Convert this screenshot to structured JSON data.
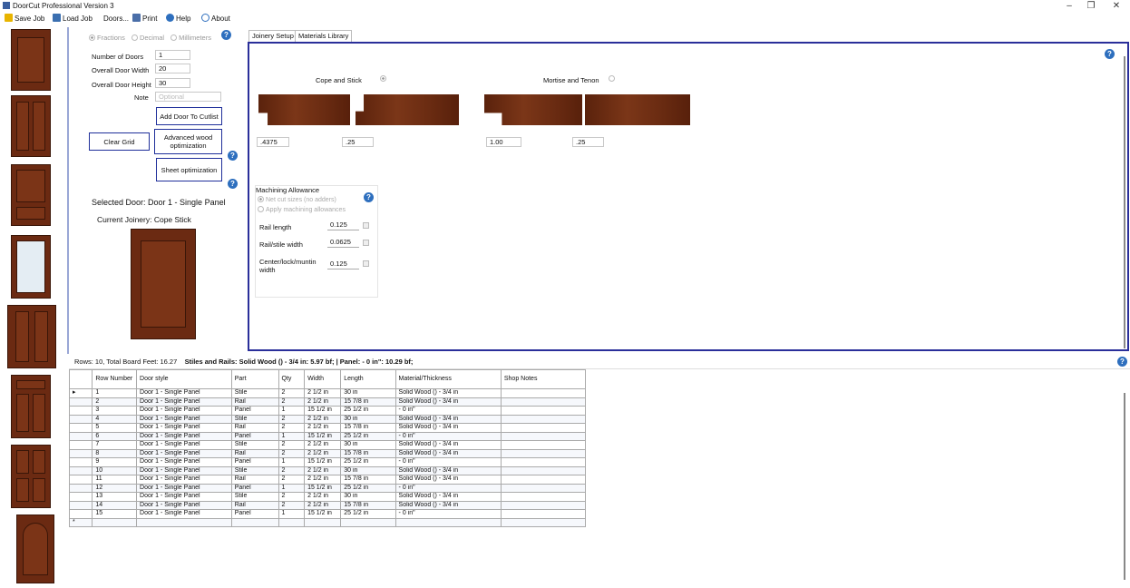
{
  "window": {
    "title": "DoorCut Professional Version 3",
    "minimize": "–",
    "maximize": "❐",
    "close": "✕"
  },
  "menu": {
    "save": "Save Job",
    "load": "Load Job",
    "doors": "Doors...",
    "print": "Print",
    "help": "Help",
    "about": "About"
  },
  "units": {
    "fractions": "Fractions",
    "decimal": "Decimal",
    "millimeters": "Millimeters",
    "selected": "Fractions"
  },
  "form": {
    "num_doors_label": "Number of Doors",
    "num_doors": "1",
    "width_label": "Overall Door Width",
    "width": "20",
    "height_label": "Overall Door Height",
    "height": "30",
    "note_label": "Note",
    "note_placeholder": "Optional"
  },
  "buttons": {
    "add": "Add Door To Cutlist",
    "clear": "Clear Grid",
    "advanced": "Advanced wood optimization",
    "sheet": "Sheet optimization"
  },
  "selected_door": "Selected Door: Door 1 - Single Panel",
  "current_joinery": "Current Joinery: Cope  Stick",
  "tabs": [
    "Joinery Setup",
    "Materials Library"
  ],
  "joinery": {
    "cope_label": "Cope and Stick",
    "mortise_label": "Mortise and Tenon",
    "cope_a": ".4375",
    "cope_b": ".25",
    "mortise_a": "1.00",
    "mortise_b": ".25"
  },
  "machining": {
    "title": "Machining Allowance",
    "opt1": "Net cut sizes (no adders)",
    "opt2": "Apply machining allowances",
    "rail_length_label": "Rail length",
    "rail_length": "0.125",
    "rail_stile_label": "Rail/stile width",
    "rail_stile": "0.0625",
    "center_label": "Center/lock/muntin width",
    "center": "0.125"
  },
  "grid_info": {
    "rows": "Rows: 10, Total Board Feet: 16.27",
    "summary": "Stiles and Rails: Solid Wood () - 3/4 in: 5.97 bf;  | Panel:  - 0 in\": 10.29 bf;"
  },
  "grid": {
    "headers": [
      "Row Number",
      "Door style",
      "Part",
      "Qty",
      "Width",
      "Length",
      "Material/Thickness",
      "Shop Notes"
    ],
    "rows": [
      [
        "1",
        "Door 1 - Single Panel",
        "Stile",
        "2",
        "2 1/2 in",
        "30 in",
        "Solid Wood () - 3/4 in",
        ""
      ],
      [
        "2",
        "Door 1 - Single Panel",
        "Rail",
        "2",
        "2 1/2 in",
        "15 7/8 in",
        "Solid Wood () - 3/4 in",
        ""
      ],
      [
        "3",
        "Door 1 - Single Panel",
        "Panel",
        "1",
        "15 1/2 in",
        "25 1/2 in",
        " - 0 in\"",
        ""
      ],
      [
        "4",
        "Door 1 - Single Panel",
        "Stile",
        "2",
        "2 1/2 in",
        "30 in",
        "Solid Wood () - 3/4 in",
        ""
      ],
      [
        "5",
        "Door 1 - Single Panel",
        "Rail",
        "2",
        "2 1/2 in",
        "15 7/8 in",
        "Solid Wood () - 3/4 in",
        ""
      ],
      [
        "6",
        "Door 1 - Single Panel",
        "Panel",
        "1",
        "15 1/2 in",
        "25 1/2 in",
        " - 0 in\"",
        ""
      ],
      [
        "7",
        "Door 1 - Single Panel",
        "Stile",
        "2",
        "2 1/2 in",
        "30 in",
        "Solid Wood () - 3/4 in",
        ""
      ],
      [
        "8",
        "Door 1 - Single Panel",
        "Rail",
        "2",
        "2 1/2 in",
        "15 7/8 in",
        "Solid Wood () - 3/4 in",
        ""
      ],
      [
        "9",
        "Door 1 - Single Panel",
        "Panel",
        "1",
        "15 1/2 in",
        "25 1/2 in",
        " - 0 in\"",
        ""
      ],
      [
        "10",
        "Door 1 - Single Panel",
        "Stile",
        "2",
        "2 1/2 in",
        "30 in",
        "Solid Wood () - 3/4 in",
        ""
      ],
      [
        "11",
        "Door 1 - Single Panel",
        "Rail",
        "2",
        "2 1/2 in",
        "15 7/8 in",
        "Solid Wood () - 3/4 in",
        ""
      ],
      [
        "12",
        "Door 1 - Single Panel",
        "Panel",
        "1",
        "15 1/2 in",
        "25 1/2 in",
        " - 0 in\"",
        ""
      ],
      [
        "13",
        "Door 1 - Single Panel",
        "Stile",
        "2",
        "2 1/2 in",
        "30 in",
        "Solid Wood () - 3/4 in",
        ""
      ],
      [
        "14",
        "Door 1 - Single Panel",
        "Rail",
        "2",
        "2 1/2 in",
        "15 7/8 in",
        "Solid Wood () - 3/4 in",
        ""
      ],
      [
        "15",
        "Door 1 - Single Panel",
        "Panel",
        "1",
        "15 1/2 in",
        "25 1/2 in",
        " - 0 in\"",
        ""
      ]
    ],
    "new_row_marker": "*",
    "current_row_marker": "▸"
  },
  "colors": {
    "accent": "#2a2f9a",
    "wood": "#6b2a12",
    "help": "#2e6fbe"
  }
}
